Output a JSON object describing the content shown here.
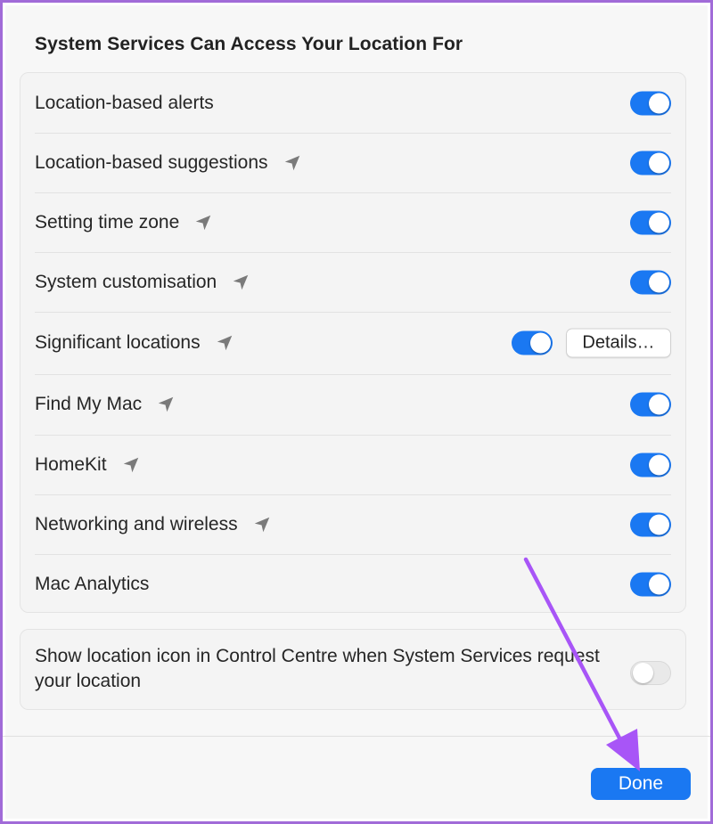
{
  "title": "System Services Can Access Your Location For",
  "services": [
    {
      "label": "Location-based alerts",
      "arrow": false,
      "enabled": true
    },
    {
      "label": "Location-based suggestions",
      "arrow": true,
      "enabled": true
    },
    {
      "label": "Setting time zone",
      "arrow": true,
      "enabled": true
    },
    {
      "label": "System customisation",
      "arrow": true,
      "enabled": true
    },
    {
      "label": "Significant locations",
      "arrow": true,
      "enabled": true,
      "button": "Details…"
    },
    {
      "label": "Find My Mac",
      "arrow": true,
      "enabled": true
    },
    {
      "label": "HomeKit",
      "arrow": true,
      "enabled": true
    },
    {
      "label": "Networking and wireless",
      "arrow": true,
      "enabled": true
    },
    {
      "label": "Mac Analytics",
      "arrow": false,
      "enabled": true
    }
  ],
  "footer": {
    "label": "Show location icon in Control Centre when System Services request your location",
    "enabled": false
  },
  "done_label": "Done",
  "colors": {
    "accent": "#1a78f2",
    "annotation_arrow": "#a855f7",
    "location_arrow_icon": "#7a7a7a"
  },
  "icons": {
    "location_arrow": "location-arrow-icon",
    "annotation": "annotation-arrow"
  }
}
